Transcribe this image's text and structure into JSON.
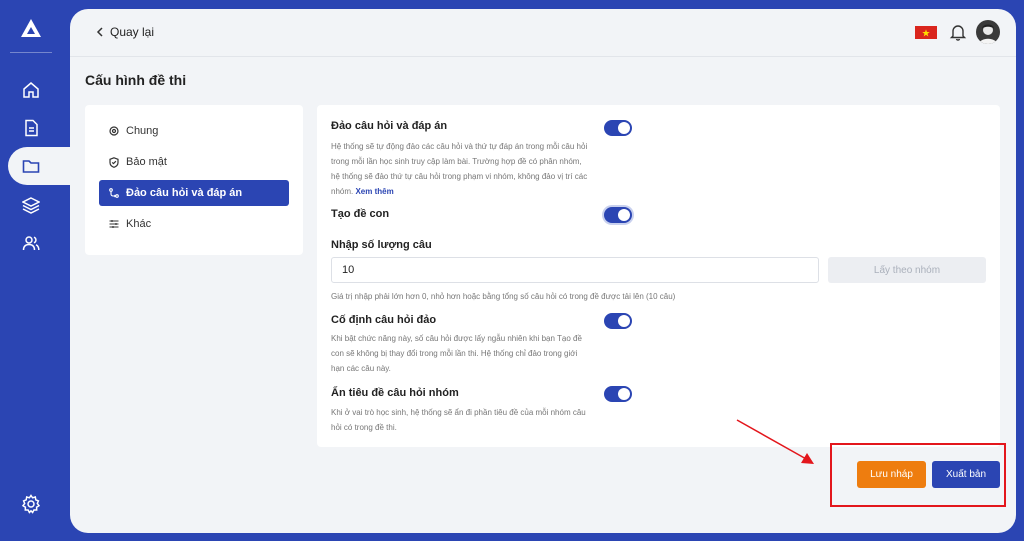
{
  "app": {
    "logo_icon": "triangle-logo-icon",
    "brand_color": "#2b45b3",
    "accent_orange": "#ee7d0f",
    "annotation_color": "#e3161c"
  },
  "rail": {
    "items": [
      {
        "name": "home-icon"
      },
      {
        "name": "document-icon"
      },
      {
        "name": "folder-icon",
        "active": true
      },
      {
        "name": "layers-icon"
      },
      {
        "name": "users-icon"
      }
    ],
    "settings_icon": "gear-icon"
  },
  "topbar": {
    "back_label": "Quay lại",
    "language_flag": "vietnam-flag-icon",
    "notification_icon": "bell-icon",
    "avatar": "user-avatar"
  },
  "page": {
    "title": "Cấu hình đề thi"
  },
  "settings_nav": {
    "items": [
      {
        "label": "Chung",
        "icon": "general-icon"
      },
      {
        "label": "Bảo mật",
        "icon": "shield-icon"
      },
      {
        "label": "Đảo câu hỏi và đáp án",
        "icon": "shuffle-icon",
        "active": true
      },
      {
        "label": "Khác",
        "icon": "sliders-icon"
      }
    ]
  },
  "content": {
    "shuffle": {
      "title": "Đảo câu hỏi và đáp án",
      "description": "Hệ thống sẽ tự động đảo các câu hỏi và thứ tự đáp án trong mỗi câu hỏi trong mỗi lần học sinh truy cập làm bài. Trường hợp đề có phân nhóm, hệ thống sẽ đảo thứ tự câu hỏi trong phạm vi nhóm, không đảo vị trí các nhóm.",
      "more_link": "Xem thêm",
      "enabled": true
    },
    "sub_exam": {
      "title": "Tạo đề con",
      "enabled": true
    },
    "quantity": {
      "label": "Nhập số lượng câu",
      "value": "10",
      "fetch_button": "Lấy theo nhóm",
      "hint": "Giá trị nhập phải lớn hơn 0, nhỏ hơn hoặc bằng tổng số câu hỏi có trong đề được tải lên (10 câu)"
    },
    "fixed_shuffle": {
      "title": "Cố định câu hỏi đảo",
      "description": "Khi bật chức năng này, số câu hỏi được lấy ngẫu nhiên khi bạn Tạo đề con sẽ không bị thay đổi trong mỗi lần thi. Hệ thống chỉ đảo trong giới hạn các câu này.",
      "enabled": true
    },
    "hide_group_title": {
      "title": "Ẩn tiêu đề câu hỏi nhóm",
      "description": "Khi ở vai trò học sinh, hệ thống sẽ ẩn đi phần tiêu đề của mỗi nhóm câu hỏi có trong đề thi.",
      "enabled": true
    }
  },
  "footer": {
    "save_draft": "Lưu nháp",
    "publish": "Xuất bản"
  }
}
